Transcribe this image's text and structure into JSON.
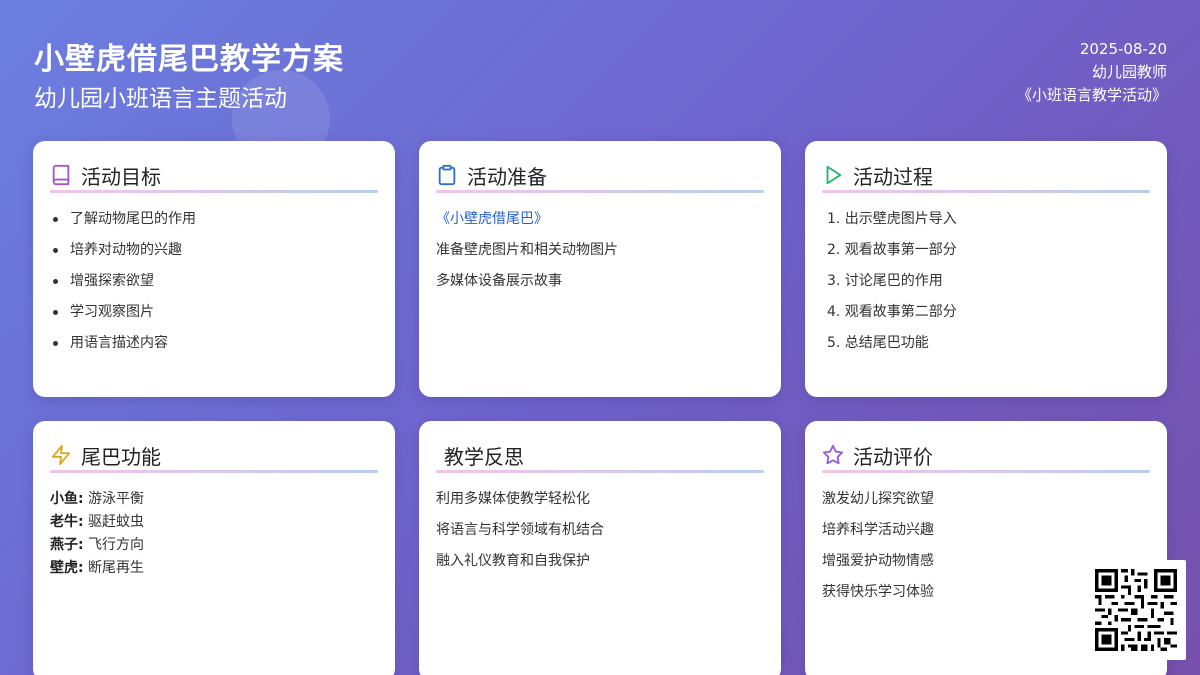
{
  "header": {
    "title": "小壁虎借尾巴教学方案",
    "subtitle": "幼儿园小班语言主题活动",
    "date": "2025-08-20",
    "author": "幼儿园教师",
    "course": "《小班语言教学活动》"
  },
  "cards": {
    "goals": {
      "title": "活动目标",
      "icon": "book-icon",
      "items": [
        "了解动物尾巴的作用",
        "培养对动物的兴趣",
        "增强探索欲望",
        "学习观察图片",
        "用语言描述内容"
      ]
    },
    "prep": {
      "title": "活动准备",
      "icon": "clipboard-icon",
      "items": [
        "《小壁虎借尾巴》",
        "准备壁虎图片和相关动物图片",
        "多媒体设备展示故事"
      ]
    },
    "process": {
      "title": "活动过程",
      "icon": "play-icon",
      "items": [
        "1. 出示壁虎图片导入",
        "2. 观看故事第一部分",
        "3. 讨论尾巴的作用",
        "4. 观看故事第二部分",
        "5. 总结尾巴功能"
      ]
    },
    "functions": {
      "title": "尾巴功能",
      "icon": "lightning-icon",
      "items": [
        {
          "animal": "小鱼:",
          "text": " 游泳平衡"
        },
        {
          "animal": "老牛:",
          "text": " 驱赶蚊虫"
        },
        {
          "animal": "燕子:",
          "text": " 飞行方向"
        },
        {
          "animal": "壁虎:",
          "text": " 断尾再生"
        }
      ]
    },
    "reflection": {
      "title": "教学反思",
      "items": [
        "利用多媒体使教学轻松化",
        "将语言与科学领域有机结合",
        "融入礼仪教育和自我保护"
      ]
    },
    "evaluation": {
      "title": "活动评价",
      "icon": "star-icon",
      "items": [
        "激发幼儿探究欲望",
        "培养科学活动兴趣",
        "增强爱护动物情感",
        "获得快乐学习体验"
      ]
    }
  },
  "colors": {
    "book_icon": "#a855c9",
    "clipboard_icon": "#2f6fd1",
    "play_icon": "#21b36b",
    "lightning_icon": "#e0a51b",
    "star_icon": "#9b59d6",
    "link": "#2a5fd0"
  }
}
